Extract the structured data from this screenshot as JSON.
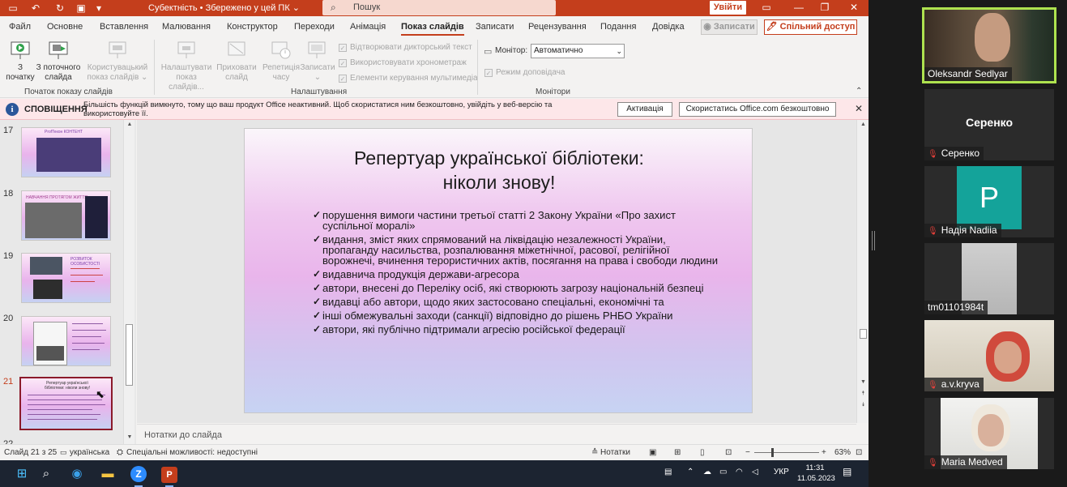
{
  "titlebar": {
    "doc_title": "Субектність • Збережено у цей ПК ⌄",
    "search_placeholder": "Пошук",
    "signin": "Увійти"
  },
  "tabs": [
    "Файл",
    "Основне",
    "Вставлення",
    "Малювання",
    "Конструктор",
    "Переходи",
    "Анімація",
    "Показ слайдів",
    "Записати",
    "Рецензування",
    "Подання",
    "Довідка"
  ],
  "active_tab": "Показ слайдів",
  "record_button": "◉ Записати",
  "share_button": "🖊 Спільний доступ",
  "ribbon": {
    "from_start": "З\nпочатку",
    "from_current": "З поточного\nслайда",
    "custom_show": "Користувацький\nпоказ слайдів ⌄",
    "setup_show": "Налаштувати\nпоказ слайдів...",
    "hide_slide": "Приховати\nслайд",
    "rehearse": "Репетиція\nчасу",
    "record": "Записати\n⌄",
    "chk_narration": "Відтворювати дикторський текст",
    "chk_timings": "Використовувати хронометраж",
    "chk_media": "Елементи керування мультимедіа",
    "monitor_label": "Монітор:",
    "monitor_value": "Автоматично",
    "presenter_view": "Режим доповідача",
    "group_start": "Початок показу слайдів",
    "group_setup": "Налаштування",
    "group_monitors": "Монітори"
  },
  "notification": {
    "title": "СПОВІЩЕННЯ",
    "text": "Більшість функцій вимкнуто, тому що ваш продукт Office неактивний. Щоб скористатися ним безкоштовно, увійдіть у веб-версію та використовуйте її.",
    "activate": "Активація",
    "use_free": "Скористатись Office.com безкоштовно"
  },
  "thumbnails": [
    {
      "num": "17",
      "title": "ProfTeкон КОНТЕНТ"
    },
    {
      "num": "18",
      "title": "НАВЧАННЯ ПРОТЯГОМ ЖИТТЯ"
    },
    {
      "num": "19",
      "title": "РОЗВИТОК ОСОБИСТОСТІ"
    },
    {
      "num": "20",
      "title": ""
    },
    {
      "num": "21",
      "title": "Репертуар української бібліотеки: ніколи знову!"
    },
    {
      "num": "22",
      "title": ""
    }
  ],
  "slide": {
    "title_line1": "Репертуар української бібліотеки:",
    "title_line2": "ніколи знову!",
    "bullets": [
      "порушення вимоги частини третьої статті 2 Закону України «Про захист суспільної моралі»",
      "видання, зміст яких спрямований на ліквідацію незалежності України, пропаганду насильства, розпалювання міжетнічної, расової, релігійної ворожнечі, вчинення терористичних актів, посягання на права і свободи людини",
      "видавнича продукція держави-агресора",
      "автори, внесені до Переліку осіб, які створюють загрозу національній безпеці",
      "видавці або автори, щодо  яких застосовано спеціальні, економічні та",
      "інші обмежувальні заходи (санкції) відповідно до рішень РНБО України",
      "автори, які публічно підтримали агресію російської федерації"
    ]
  },
  "notes_placeholder": "Нотатки до слайда",
  "statusbar": {
    "slide_info": "Слайд 21 з 25",
    "language": "українська",
    "accessibility": "Спеціальні можливості: недоступні",
    "notes": "Нотатки",
    "zoom": "63%"
  },
  "taskbar": {
    "lang": "УКР",
    "time": "11:31",
    "date": "11.05.2023"
  },
  "participants": [
    {
      "name": "Oleksandr Sedlyar",
      "muted": false,
      "video": true,
      "speaker": true
    },
    {
      "name": "Серенко",
      "muted": true,
      "video": false
    },
    {
      "name": "Надія Nadiia",
      "muted": true,
      "video": false,
      "initial": "P"
    },
    {
      "name": "tm01101984t",
      "muted": false,
      "video": true
    },
    {
      "name": "a.v.kryva",
      "muted": true,
      "video": true
    },
    {
      "name": "Maria Medved",
      "muted": true,
      "video": true
    }
  ]
}
